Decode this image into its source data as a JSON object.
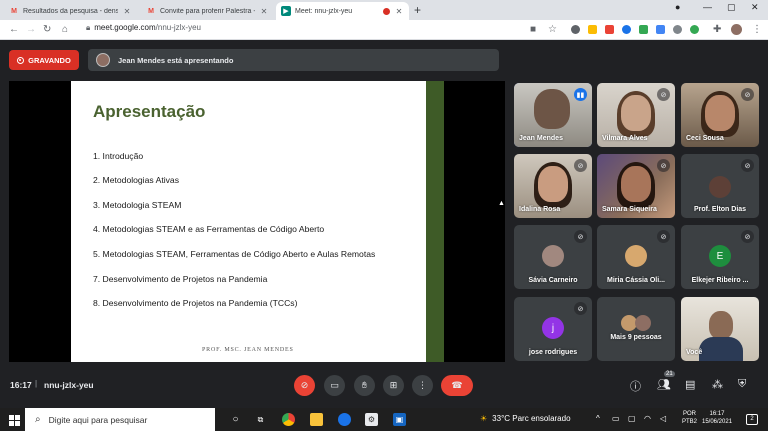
{
  "browser": {
    "tabs": [
      {
        "title": "Resultados da pesquisa - dens.co",
        "favicon": "M",
        "favicon_color": "#ea4335"
      },
      {
        "title": "Convite para proferir Palestra - d",
        "favicon": "M",
        "favicon_color": "#ea4335"
      },
      {
        "title": "Meet: nnu-jzlx-yeu",
        "favicon": "▶",
        "favicon_color": "#00897b"
      }
    ],
    "new_tab": "+",
    "url_host": "meet.google.com",
    "url_path": "/nnu-jzlx-yeu"
  },
  "meet": {
    "recording_label": "GRAVANDO",
    "presenting_text": "Jean Mendes está apresentando",
    "meeting_code": "nnu-jzlx-yeu",
    "time": "16:17",
    "separator": "|",
    "participants_badge": "21"
  },
  "slide": {
    "title": "Apresentação",
    "items": [
      "1. Introdução",
      "2. Metodologias Ativas",
      "3. Metodologia STEAM",
      "4. Metodologias STEAM e as Ferramentas de Código Aberto",
      "5. Metodologias STEAM, Ferramentas de Código Aberto e Aulas Remotas",
      "7. Desenvolvimento de Projetos na Pandemia",
      "8. Desenvolvimento de Projetos na Pandemia  (TCCs)"
    ],
    "footer": "Prof. Msc. Jean Mendes"
  },
  "participants": [
    {
      "name": "Jean Mendes",
      "type": "video",
      "speaking": true
    },
    {
      "name": "Vilmara Alves",
      "type": "video"
    },
    {
      "name": "Ceci Sousa",
      "type": "video"
    },
    {
      "name": "Idalina Rosa",
      "type": "video"
    },
    {
      "name": "Samara Siqueira",
      "type": "video"
    },
    {
      "name": "Prof. Elton Dias",
      "type": "photo"
    },
    {
      "name": "Sávia Carneiro",
      "type": "photo"
    },
    {
      "name": "Miria Cássia Oli...",
      "type": "photo"
    },
    {
      "name": "Elkejer Ribeiro ...",
      "type": "letter",
      "letter": "E",
      "color": "#1e8e3e"
    },
    {
      "name": "jose rodrigues",
      "type": "letter",
      "letter": "j",
      "color": "#9334e6"
    },
    {
      "name": "Mais 9 pessoas",
      "type": "group"
    },
    {
      "name": "Você",
      "type": "video"
    }
  ],
  "taskbar": {
    "search_placeholder": "Digite aqui para pesquisar",
    "weather": "33°C  Parc ensolarado",
    "lang_top": "POR",
    "lang_bottom": "PTB2",
    "clock_time": "16:17",
    "clock_date": "15/06/2021",
    "notifications": "2"
  }
}
